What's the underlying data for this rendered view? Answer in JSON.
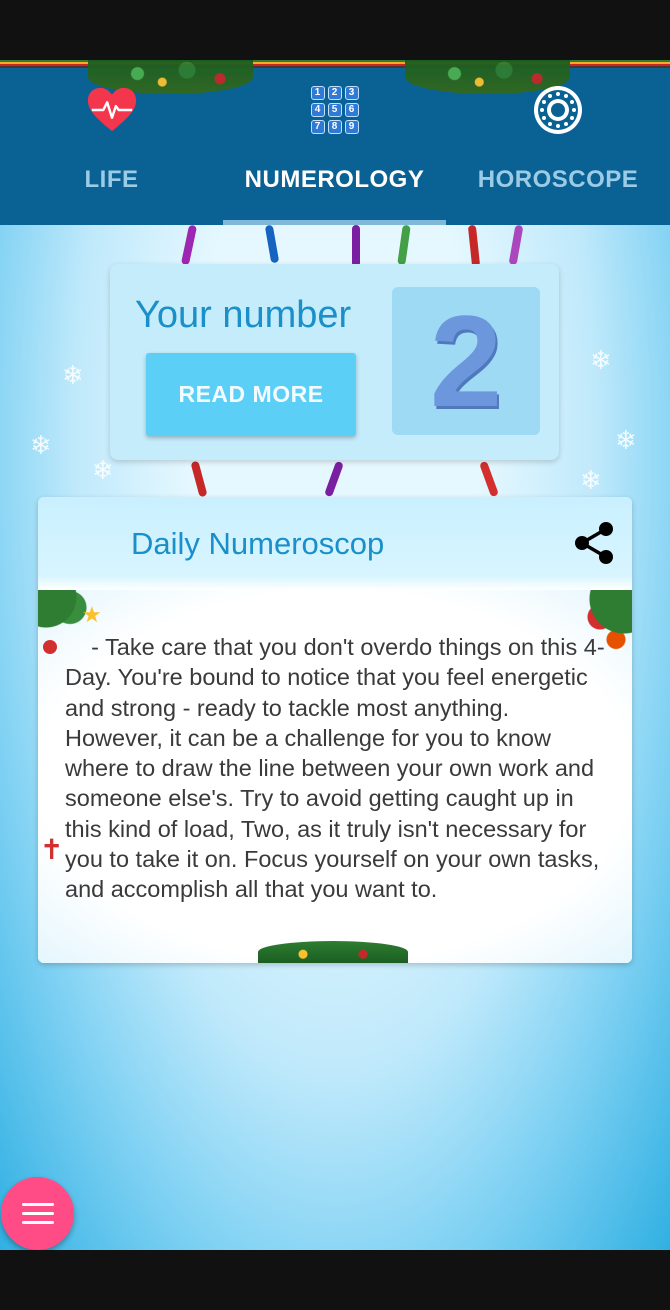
{
  "tabs": [
    {
      "label": "LIFE",
      "icon": "heartbeat-icon",
      "active": false
    },
    {
      "label": "NUMEROLOGY",
      "icon": "number-grid-icon",
      "active": true
    },
    {
      "label": "HOROSCOPE",
      "icon": "zodiac-wheel-icon",
      "active": false
    }
  ],
  "numerology_grid": [
    "1",
    "2",
    "3",
    "4",
    "5",
    "6",
    "7",
    "8",
    "9"
  ],
  "number_card": {
    "title": "Your number",
    "button_label": "READ MORE",
    "number": "2"
  },
  "daily": {
    "title": "Daily Numeroscop",
    "share_icon": "share-icon",
    "text": "    - Take care that you don't overdo things on this 4-Day. You're bound to notice that you feel energetic and strong - ready to tackle most anything. However, it can be a challenge for you to know where to draw the line between your own work and someone else's. Try to avoid getting caught up in this kind of load, Two, as it truly isn't necessary for you to take it on. Focus yourself on your own tasks, and accomplish all that you want to."
  },
  "fab": {
    "icon": "menu-icon"
  },
  "colors": {
    "tabbar": "#0a6294",
    "accent": "#1a8fc9",
    "button": "#5ccff7",
    "fab": "#ff4b86",
    "heart": "#f4364c"
  }
}
